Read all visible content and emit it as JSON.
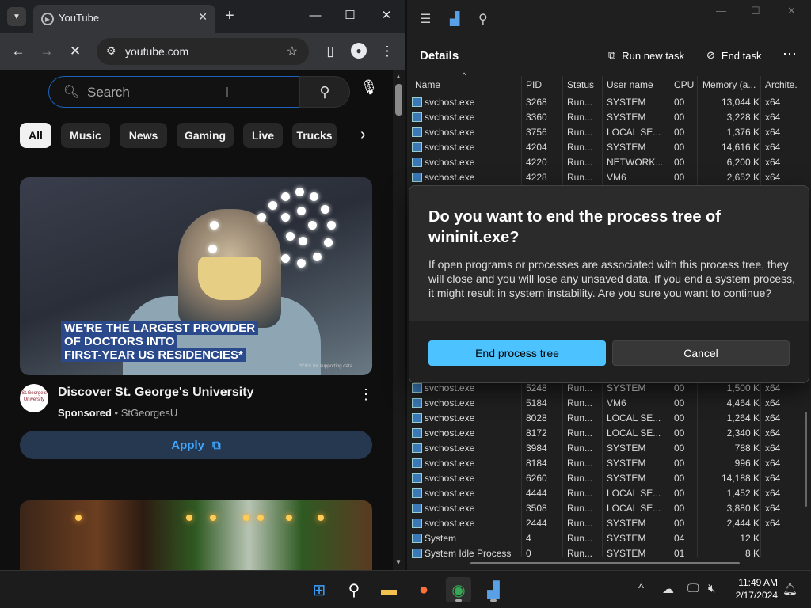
{
  "chrome": {
    "tab_title": "YouTube",
    "url": "youtube.com",
    "icons": [
      "chevron-down-icon",
      "youtube-favicon-icon",
      "close-icon",
      "plus-icon",
      "minimize-icon",
      "maximize-icon",
      "close-window-icon",
      "back-icon",
      "forward-icon",
      "stop-icon",
      "site-settings-icon",
      "star-icon",
      "side-panel-icon",
      "profile-icon",
      "more-icon"
    ]
  },
  "youtube": {
    "search_placeholder": "Search",
    "chips": [
      "All",
      "Music",
      "News",
      "Gaming",
      "Live",
      "Trucks"
    ],
    "ad": {
      "caption_lines": [
        "WE'RE THE LARGEST PROVIDER",
        "OF DOCTORS INTO",
        "FIRST-YEAR US RESIDENCIES*"
      ],
      "fine_print": "*Click for supporting data",
      "channel_logo_text": "St.George's University",
      "title": "Discover St. George's University",
      "sponsored": "Sponsored",
      "separator": "•",
      "channel": "StGeorgesU",
      "apply_label": "Apply"
    }
  },
  "taskmanager": {
    "page_title": "Details",
    "run_new_task": "Run new task",
    "end_task": "End task",
    "columns": [
      "Name",
      "PID",
      "Status",
      "User name",
      "CPU",
      "Memory (a...",
      "Archite."
    ],
    "rows_top": [
      [
        "svchost.exe",
        "3268",
        "Run...",
        "SYSTEM",
        "00",
        "13,044 K",
        "x64"
      ],
      [
        "svchost.exe",
        "3360",
        "Run...",
        "SYSTEM",
        "00",
        "3,228 K",
        "x64"
      ],
      [
        "svchost.exe",
        "3756",
        "Run...",
        "LOCAL SE...",
        "00",
        "1,376 K",
        "x64"
      ],
      [
        "svchost.exe",
        "4204",
        "Run...",
        "SYSTEM",
        "00",
        "14,616 K",
        "x64"
      ],
      [
        "svchost.exe",
        "4220",
        "Run...",
        "NETWORK...",
        "00",
        "6,200 K",
        "x64"
      ],
      [
        "svchost.exe",
        "4228",
        "Run...",
        "VM6",
        "00",
        "2,652 K",
        "x64"
      ]
    ],
    "rows_bottom": [
      [
        "svchost.exe",
        "5248",
        "Run...",
        "SYSTEM",
        "00",
        "1,500 K",
        "x64"
      ],
      [
        "svchost.exe",
        "5184",
        "Run...",
        "VM6",
        "00",
        "4,464 K",
        "x64"
      ],
      [
        "svchost.exe",
        "8028",
        "Run...",
        "LOCAL SE...",
        "00",
        "1,264 K",
        "x64"
      ],
      [
        "svchost.exe",
        "8172",
        "Run...",
        "LOCAL SE...",
        "00",
        "2,340 K",
        "x64"
      ],
      [
        "svchost.exe",
        "3984",
        "Run...",
        "SYSTEM",
        "00",
        "788 K",
        "x64"
      ],
      [
        "svchost.exe",
        "8184",
        "Run...",
        "SYSTEM",
        "00",
        "996 K",
        "x64"
      ],
      [
        "svchost.exe",
        "6260",
        "Run...",
        "SYSTEM",
        "00",
        "14,188 K",
        "x64"
      ],
      [
        "svchost.exe",
        "4444",
        "Run...",
        "LOCAL SE...",
        "00",
        "1,452 K",
        "x64"
      ],
      [
        "svchost.exe",
        "3508",
        "Run...",
        "LOCAL SE...",
        "00",
        "3,880 K",
        "x64"
      ],
      [
        "svchost.exe",
        "2444",
        "Run...",
        "SYSTEM",
        "00",
        "2,444 K",
        "x64"
      ],
      [
        "System",
        "4",
        "Run...",
        "SYSTEM",
        "04",
        "12 K",
        ""
      ],
      [
        "System Idle Process",
        "0",
        "Run...",
        "SYSTEM",
        "01",
        "8 K",
        ""
      ]
    ]
  },
  "dialog": {
    "title": "Do you want to end the process tree of wininit.exe?",
    "body": "If open programs or processes are associated with this process tree, they will close and you will lose any unsaved data. If you end a system process, it might result in system instability. Are you sure you want to continue?",
    "primary_label": "End process tree",
    "secondary_label": "Cancel"
  },
  "taskbar": {
    "time": "11:49 AM",
    "date": "2/17/2024",
    "apps": [
      "start-icon",
      "search-icon",
      "file-explorer-icon",
      "firefox-icon",
      "chrome-icon",
      "task-manager-icon"
    ]
  },
  "colors": {
    "accent": "#4cc2ff",
    "youtube_link": "#3ea6ff",
    "search_focus": "#1c62b9"
  }
}
